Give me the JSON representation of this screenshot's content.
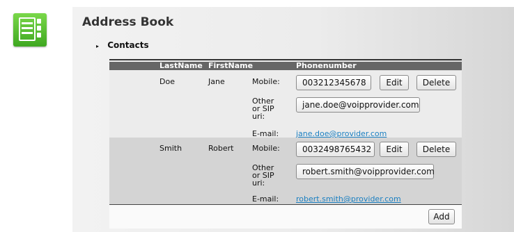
{
  "header": {
    "title": "Address Book",
    "icon": "address-book-icon",
    "icon_color": "#4cbb2c"
  },
  "section": {
    "label": "Contacts",
    "arrow": "▸"
  },
  "table": {
    "columns": {
      "lastname": "LastName",
      "firstname": "FirstName",
      "phone": "Phonenumber"
    },
    "labels": {
      "mobile": "Mobile:",
      "other_line1": "Other",
      "other_line2": "or SIP",
      "other_line3": "uri:",
      "email": "E-mail:"
    },
    "buttons": {
      "edit": "Edit",
      "delete": "Delete",
      "add": "Add"
    },
    "rows": [
      {
        "lastname": "Doe",
        "firstname": "Jane",
        "mobile": "003212345678",
        "sip": "jane.doe@voipprovider.com",
        "email": "jane.doe@provider.com"
      },
      {
        "lastname": "Smith",
        "firstname": "Robert",
        "mobile": "0032498765432",
        "sip": "robert.smith@voipprovider.com",
        "email": "robert.smith@provider.com"
      }
    ]
  },
  "colors": {
    "header_bar": "#666666",
    "link": "#1a7fc1",
    "row_odd": "#ececec",
    "row_even": "#d4d4d4"
  }
}
